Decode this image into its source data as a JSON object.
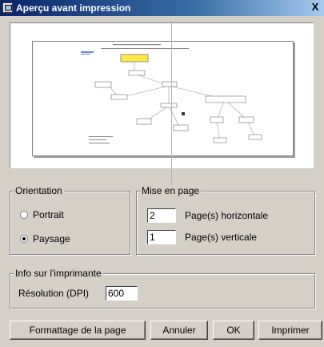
{
  "window": {
    "title": "Aperçu avant impression",
    "close_label": "X"
  },
  "orientation": {
    "title": "Orientation",
    "options": [
      {
        "label": "Portrait",
        "selected": false
      },
      {
        "label": "Paysage",
        "selected": true
      }
    ]
  },
  "layout": {
    "title": "Mise en page",
    "horizontal_value": "2",
    "horizontal_label": "Page(s) horizontale",
    "vertical_value": "1",
    "vertical_label": "Page(s) verticale"
  },
  "printer": {
    "title": "Info sur l'imprimante",
    "resolution_label": "Résolution (DPI)",
    "resolution_value": "600"
  },
  "buttons": {
    "page_format": "Formattage de la page",
    "cancel": "Annuler",
    "ok": "OK",
    "print": "Imprimer"
  }
}
